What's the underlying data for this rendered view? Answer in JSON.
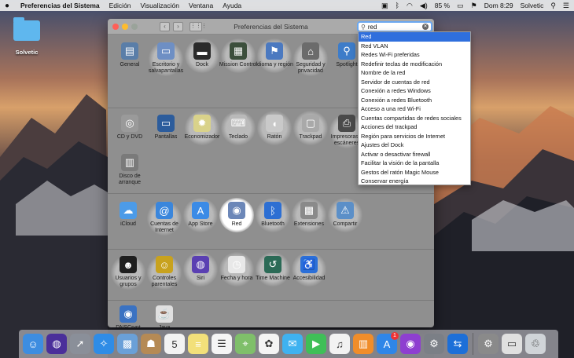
{
  "menubar": {
    "apple": "",
    "items": [
      "Preferencias del Sistema",
      "Edición",
      "Visualización",
      "Ventana",
      "Ayuda"
    ],
    "battery": "85 %",
    "clock": "Dom 8:29",
    "user": "Solvetic"
  },
  "desktop": {
    "folder_label": "Solvetic"
  },
  "window": {
    "title": "Preferencias del Sistema",
    "search_value": "red",
    "sections": [
      [
        {
          "label": "General",
          "icon": "general-icon",
          "color": "#5a7ea8",
          "glyph": "▤"
        },
        {
          "label": "Escritorio y salvapantallas",
          "icon": "desktop-icon",
          "color": "#6e8fc4",
          "glyph": "▭"
        },
        {
          "label": "Dock",
          "icon": "dock-icon",
          "color": "#2b2b2b",
          "glyph": "▬"
        },
        {
          "label": "Mission Control",
          "icon": "mission-control-icon",
          "color": "#3c4f3c",
          "glyph": "▦"
        },
        {
          "label": "Idioma y región",
          "icon": "language-icon",
          "color": "#4b79c0",
          "glyph": "⚑"
        },
        {
          "label": "Seguridad y privacidad",
          "icon": "security-icon",
          "color": "#6b6b6b",
          "glyph": "⌂"
        },
        {
          "label": "Spotlight",
          "icon": "spotlight-icon",
          "color": "#3d7cc9",
          "glyph": "⚲"
        }
      ],
      [
        {
          "label": "CD y DVD",
          "icon": "cd-icon",
          "color": "#9a9a9a",
          "glyph": "◎"
        },
        {
          "label": "Pantallas",
          "icon": "displays-icon",
          "color": "#2c5c9c",
          "glyph": "▭"
        },
        {
          "label": "Economizador",
          "icon": "bulb-icon",
          "color": "#d9d28a",
          "glyph": "✹"
        },
        {
          "label": "Teclado",
          "icon": "keyboard-icon",
          "color": "#b9b9b9",
          "glyph": "⌨"
        },
        {
          "label": "Ratón",
          "icon": "mouse-icon",
          "color": "#c9c9c9",
          "glyph": "◖"
        },
        {
          "label": "Trackpad",
          "icon": "trackpad-icon",
          "color": "#a9a9a9",
          "glyph": "▢"
        },
        {
          "label": "Impresoras y escáneres",
          "icon": "printer-icon",
          "color": "#4a4a4a",
          "glyph": "⎙"
        },
        {
          "label": "Disco de arranque",
          "icon": "disk-icon",
          "color": "#7a7a7a",
          "glyph": "▥"
        }
      ],
      [
        {
          "label": "iCloud",
          "icon": "icloud-icon",
          "color": "#4c9be8",
          "glyph": "☁"
        },
        {
          "label": "Cuentas de Internet",
          "icon": "internet-accounts-icon",
          "color": "#3a86dc",
          "glyph": "@"
        },
        {
          "label": "App Store",
          "icon": "app-store-icon",
          "color": "#3b8be6",
          "glyph": "A"
        },
        {
          "label": "Red",
          "icon": "network-icon",
          "color": "#6c87b8",
          "glyph": "◉"
        },
        {
          "label": "Bluetooth",
          "icon": "bluetooth-icon",
          "color": "#2d6fd3",
          "glyph": "ᛒ"
        },
        {
          "label": "Extensiones",
          "icon": "extensions-icon",
          "color": "#8a8a8a",
          "glyph": "▩"
        },
        {
          "label": "Compartir",
          "icon": "sharing-icon",
          "color": "#5b8fc8",
          "glyph": "⚠"
        }
      ],
      [
        {
          "label": "Usuarios y grupos",
          "icon": "users-icon",
          "color": "#1f1f1f",
          "glyph": "☻"
        },
        {
          "label": "Controles parentales",
          "icon": "parental-icon",
          "color": "#c8a21e",
          "glyph": "☺"
        },
        {
          "label": "Siri",
          "icon": "siri-icon",
          "color": "#5a3fb2",
          "glyph": "◍"
        },
        {
          "label": "Fecha y hora",
          "icon": "clock-icon",
          "color": "#e8e8e8",
          "glyph": "◷"
        },
        {
          "label": "Time Machine",
          "icon": "time-machine-icon",
          "color": "#2b6a56",
          "glyph": "↺"
        },
        {
          "label": "Accesibilidad",
          "icon": "accessibility-icon",
          "color": "#2b6fd8",
          "glyph": "♿"
        }
      ],
      [
        {
          "label": "DNSCrypt",
          "icon": "dnscrypt-icon",
          "color": "#3a72c2",
          "glyph": "◉"
        },
        {
          "label": "Java",
          "icon": "java-icon",
          "color": "#e0e0e0",
          "glyph": "☕"
        }
      ]
    ]
  },
  "dropdown": {
    "options": [
      "Red",
      "Red VLAN",
      "Redes Wi-Fi preferidas",
      "Redefinir teclas de modificación",
      "Nombre de la red",
      "Servidor de cuentas de red",
      "Conexión a redes Windows",
      "Conexión a redes Bluetooth",
      "Acceso a una red Wi-Fi",
      "Cuentas compartidas de redes sociales",
      "Acciones del trackpad",
      "Región para servicios de Internet",
      "Ajustes del Dock",
      "Activar o desactivar firewall",
      "Facilitar la visión de la pantalla",
      "Gestos del ratón Magic Mouse",
      "Conservar energía"
    ]
  },
  "dock": {
    "apps": [
      {
        "icon": "finder-icon",
        "color": "#3d8de0",
        "glyph": "☺"
      },
      {
        "icon": "siri-icon",
        "color": "#4a2f9a",
        "glyph": "◍"
      },
      {
        "icon": "launchpad-icon",
        "color": "#8a8f99",
        "glyph": "➚"
      },
      {
        "icon": "safari-icon",
        "color": "#2f8ce6",
        "glyph": "✧"
      },
      {
        "icon": "photo-icon",
        "color": "#6aa0d8",
        "glyph": "▩"
      },
      {
        "icon": "contacts-icon",
        "color": "#b58a55",
        "glyph": "☗"
      },
      {
        "icon": "calendar-icon",
        "color": "#f3f3f3",
        "glyph": "5"
      },
      {
        "icon": "notes-icon",
        "color": "#f2e07a",
        "glyph": "≡"
      },
      {
        "icon": "reminders-icon",
        "color": "#f5f5f5",
        "glyph": "☰"
      },
      {
        "icon": "maps-icon",
        "color": "#7fbf6a",
        "glyph": "⌖"
      },
      {
        "icon": "photos-icon",
        "color": "#f4f4f4",
        "glyph": "✿"
      },
      {
        "icon": "messages-icon",
        "color": "#3fb2f0",
        "glyph": "✉"
      },
      {
        "icon": "facetime-icon",
        "color": "#3fbf57",
        "glyph": "▶"
      },
      {
        "icon": "itunes-icon",
        "color": "#f2f2f2",
        "glyph": "♫"
      },
      {
        "icon": "ibooks-icon",
        "color": "#f08d2a",
        "glyph": "▥"
      },
      {
        "icon": "app-store-icon",
        "color": "#2f86e8",
        "glyph": "A",
        "badge": "1"
      },
      {
        "icon": "podcast-icon",
        "color": "#8e3fd0",
        "glyph": "◉"
      },
      {
        "icon": "system-preferences-icon",
        "color": "#7b7f86",
        "glyph": "⚙"
      },
      {
        "icon": "teamviewer-icon",
        "color": "#1d6fd8",
        "glyph": "⇆"
      }
    ],
    "right": [
      {
        "icon": "disk-utility-icon",
        "color": "#8a8a8a",
        "glyph": "⚙"
      },
      {
        "icon": "window-icon",
        "color": "#e0e0e0",
        "glyph": "▭"
      },
      {
        "icon": "trash-icon",
        "color": "#d0d4d8",
        "glyph": "♲"
      }
    ]
  }
}
